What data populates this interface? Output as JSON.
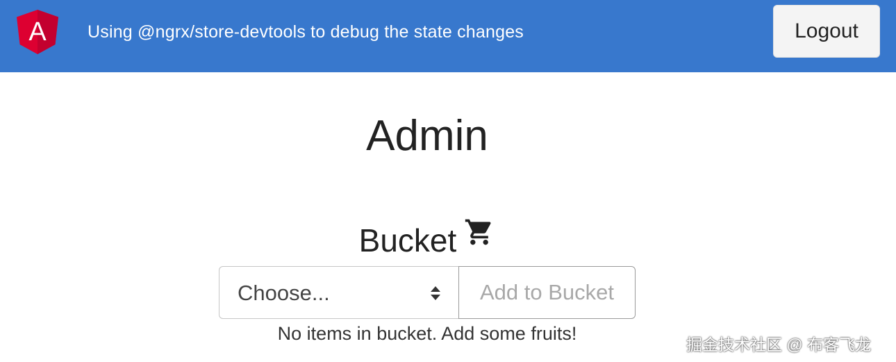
{
  "header": {
    "title": "Using @ngrx/store-devtools to debug the state changes",
    "logout_label": "Logout",
    "logo_icon": "angular-logo-icon",
    "logo_letter": "A",
    "brand_color": "#3878cd"
  },
  "main": {
    "page_title": "Admin",
    "bucket_heading": "Bucket",
    "cart_icon": "shopping-cart-icon",
    "select": {
      "selected": "Choose..."
    },
    "add_button_label": "Add to Bucket",
    "empty_message": "No items in bucket. Add some fruits!"
  },
  "watermark": "掘金技术社区 @ 布客飞龙"
}
